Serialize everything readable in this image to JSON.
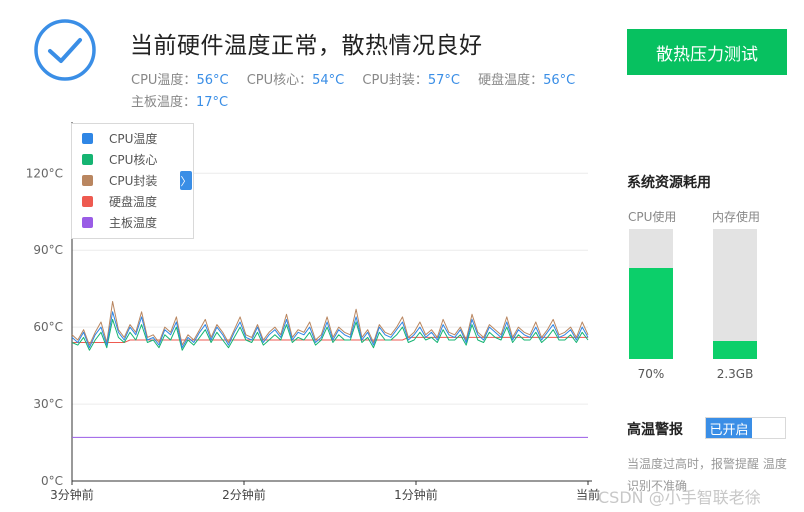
{
  "status": {
    "icon": "check-circle-icon",
    "headline": "当前硬件温度正常，散热情况良好",
    "readings": [
      {
        "label": "CPU温度：",
        "value": "56°C"
      },
      {
        "label": "CPU核心：",
        "value": "54°C"
      },
      {
        "label": "CPU封装：",
        "value": "57°C"
      },
      {
        "label": "硬盘温度：",
        "value": "56°C"
      },
      {
        "label": "主板温度：",
        "value": "17°C"
      }
    ]
  },
  "actions": {
    "stress_test": "散热压力测试"
  },
  "colors": {
    "accent": "#3a8ee6",
    "green": "#07c160"
  },
  "chart_data": {
    "type": "line",
    "ylim": [
      0,
      140
    ],
    "yticks": [
      "0°C",
      "30°C",
      "60°C",
      "90°C",
      "120°C"
    ],
    "ytick_values": [
      0,
      30,
      60,
      90,
      120
    ],
    "xticks": [
      "3分钟前",
      "2分钟前",
      "1分钟前",
      "当前"
    ],
    "series": [
      {
        "name": "CPU温度",
        "color": "#2f86e5",
        "values": [
          56,
          54,
          58,
          52,
          57,
          60,
          53,
          66,
          58,
          55,
          60,
          57,
          64,
          55,
          56,
          53,
          59,
          57,
          62,
          52,
          56,
          54,
          58,
          61,
          55,
          60,
          57,
          53,
          58,
          62,
          56,
          55,
          60,
          54,
          57,
          59,
          56,
          63,
          55,
          58,
          57,
          60,
          54,
          56,
          62,
          55,
          59,
          57,
          56,
          64,
          55,
          58,
          53,
          60,
          57,
          56,
          59,
          62,
          55,
          57,
          60,
          56,
          58,
          55,
          61,
          57,
          56,
          59,
          54,
          63,
          57,
          55,
          60,
          58,
          56,
          62,
          55,
          59,
          57,
          56,
          60,
          55,
          58,
          61,
          56,
          57,
          59,
          55,
          60,
          56
        ]
      },
      {
        "name": "CPU核心",
        "color": "#15b472",
        "values": [
          54,
          53,
          56,
          51,
          55,
          58,
          52,
          63,
          56,
          54,
          58,
          55,
          61,
          54,
          55,
          52,
          57,
          55,
          60,
          51,
          55,
          53,
          56,
          59,
          54,
          58,
          55,
          52,
          56,
          60,
          55,
          54,
          58,
          53,
          55,
          57,
          55,
          61,
          54,
          56,
          55,
          58,
          53,
          55,
          60,
          54,
          57,
          55,
          55,
          62,
          54,
          56,
          52,
          58,
          55,
          55,
          57,
          60,
          54,
          55,
          58,
          55,
          56,
          54,
          59,
          55,
          55,
          57,
          53,
          61,
          55,
          54,
          58,
          56,
          55,
          60,
          54,
          57,
          55,
          55,
          58,
          54,
          56,
          59,
          55,
          55,
          57,
          54,
          58,
          55
        ]
      },
      {
        "name": "CPU封装",
        "color": "#b98660",
        "values": [
          57,
          55,
          59,
          53,
          58,
          62,
          54,
          70,
          59,
          56,
          61,
          58,
          66,
          56,
          57,
          54,
          60,
          58,
          64,
          53,
          57,
          55,
          59,
          63,
          56,
          61,
          58,
          54,
          59,
          64,
          57,
          56,
          61,
          55,
          58,
          60,
          57,
          65,
          56,
          59,
          58,
          62,
          55,
          57,
          64,
          56,
          60,
          58,
          57,
          67,
          56,
          59,
          54,
          61,
          58,
          57,
          60,
          64,
          56,
          58,
          62,
          57,
          59,
          56,
          63,
          58,
          57,
          60,
          55,
          65,
          58,
          56,
          61,
          59,
          57,
          64,
          56,
          60,
          58,
          57,
          62,
          56,
          59,
          63,
          57,
          58,
          60,
          56,
          62,
          57
        ]
      },
      {
        "name": "硬盘温度",
        "color": "#ee5a50",
        "values": [
          54,
          54,
          54,
          54,
          54,
          54,
          54,
          54,
          54,
          54,
          55,
          55,
          55,
          55,
          55,
          55,
          55,
          55,
          55,
          55,
          55,
          55,
          55,
          55,
          55,
          55,
          55,
          55,
          55,
          55,
          55,
          55,
          55,
          55,
          55,
          55,
          55,
          55,
          55,
          55,
          55,
          55,
          55,
          55,
          55,
          55,
          55,
          55,
          55,
          55,
          55,
          55,
          55,
          55,
          55,
          55,
          55,
          55,
          56,
          56,
          56,
          56,
          56,
          56,
          56,
          56,
          56,
          56,
          56,
          56,
          56,
          56,
          56,
          56,
          56,
          56,
          56,
          56,
          56,
          56,
          56,
          56,
          56,
          56,
          56,
          56,
          56,
          56,
          56,
          56
        ]
      },
      {
        "name": "主板温度",
        "color": "#9a5ce6",
        "values": [
          17,
          17,
          17,
          17,
          17,
          17,
          17,
          17,
          17,
          17,
          17,
          17,
          17,
          17,
          17,
          17,
          17,
          17,
          17,
          17,
          17,
          17,
          17,
          17,
          17,
          17,
          17,
          17,
          17,
          17,
          17,
          17,
          17,
          17,
          17,
          17,
          17,
          17,
          17,
          17,
          17,
          17,
          17,
          17,
          17,
          17,
          17,
          17,
          17,
          17,
          17,
          17,
          17,
          17,
          17,
          17,
          17,
          17,
          17,
          17,
          17,
          17,
          17,
          17,
          17,
          17,
          17,
          17,
          17,
          17,
          17,
          17,
          17,
          17,
          17,
          17,
          17,
          17,
          17,
          17,
          17,
          17,
          17,
          17,
          17,
          17,
          17,
          17,
          17,
          17
        ]
      }
    ]
  },
  "legend_toggle": "〉",
  "resources": {
    "title": "系统资源耗用",
    "cpu": {
      "label": "CPU使用",
      "value": "70%",
      "fill": 0.7
    },
    "mem": {
      "label": "内存使用",
      "value": "2.3GB",
      "fill": 0.14
    }
  },
  "alarm": {
    "title": "高温警报",
    "toggle_on": "已开启",
    "desc": "当温度过高时，报警提醒 温度识别不准确"
  },
  "watermark": "CSDN @小手智联老徐"
}
